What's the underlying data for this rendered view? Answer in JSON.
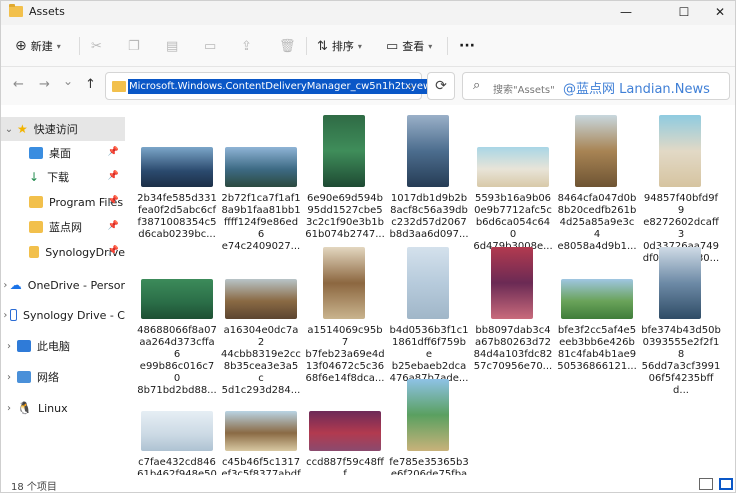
{
  "window": {
    "title": "Assets",
    "minimize": "—",
    "maximize": "☐",
    "close": "✕"
  },
  "toolbar": {
    "new_label": "新建",
    "sort_label": "排序",
    "view_label": "查看",
    "more_label": "···"
  },
  "nav": {
    "back": "←",
    "forward": "→",
    "recent": "⌄",
    "up": "↑"
  },
  "address": {
    "path": "Microsoft.Windows.ContentDeliveryManager_cw5n1h2txyew",
    "dropdown": "⌄",
    "refresh": "⟳"
  },
  "search": {
    "placeholder": "搜索\"Assets\""
  },
  "watermark": "@蓝点网 Landian.News",
  "sidebar": {
    "items": [
      {
        "label": "快速访问"
      },
      {
        "label": "桌面"
      },
      {
        "label": "下载"
      },
      {
        "label": "Program Files"
      },
      {
        "label": "蓝点网"
      },
      {
        "label": "SynologyDrive"
      },
      {
        "label": "OneDrive - Persor"
      },
      {
        "label": "Synology Drive - C"
      },
      {
        "label": "此电脑"
      },
      {
        "label": "网络"
      },
      {
        "label": "Linux"
      }
    ]
  },
  "files": [
    {
      "l1": "2b34fe585d331",
      "l2": "fea0f2d5abc6cf",
      "l3": "f3871008354c5",
      "l4": "d6cab0239bc..."
    },
    {
      "l1": "2b72f1ca7f1af1",
      "l2": "8a9b1faa81bb1",
      "l3": "ffff124f9e86ed6",
      "l4": "e74c2409027..."
    },
    {
      "l1": "6e90e69d594b",
      "l2": "95dd1527cbe5",
      "l3": "3c2c1f90e3b1b",
      "l4": "61b074b2747..."
    },
    {
      "l1": "1017db1d9b2b",
      "l2": "8acf8c56a39db",
      "l3": "c232d57d2067",
      "l4": "b8d3aa6d097..."
    },
    {
      "l1": "5593b16a9b06",
      "l2": "0e9b7712afc5c",
      "l3": "b6d6ca054c640",
      "l4": "6d479b3008e..."
    },
    {
      "l1": "8464cfa047d0b",
      "l2": "8b20cedfb261b",
      "l3": "4d25a85a9e3c4",
      "l4": "e8058a4d9b1..."
    },
    {
      "l1": "94857f40bfd9f9",
      "l2": "e8272602dcaff3",
      "l3": "0d33726aa749",
      "l4": "df056db1e30..."
    },
    {
      "l1": "48688066f8a07",
      "l2": "aa264d373cffa6",
      "l3": "e99b86c016c70",
      "l4": "8b71bd2bd88..."
    },
    {
      "l1": "a16304e0dc7a2",
      "l2": "44cbb8319e2cc",
      "l3": "8b35cea3e3a5c",
      "l4": "5d1c293d284..."
    },
    {
      "l1": "a1514069c95b7",
      "l2": "b7feb23a69e4d",
      "l3": "13f04672c5c36",
      "l4": "68f6e14f8dca..."
    },
    {
      "l1": "b4d0536b3f1c1",
      "l2": "1861dff6f759be",
      "l3": "b25ebaeb2dca",
      "l4": "476a87b7ade..."
    },
    {
      "l1": "bb8097dab3c4",
      "l2": "a67b80263d72",
      "l3": "84d4a103fdc82",
      "l4": "57c70956e70..."
    },
    {
      "l1": "bfe3f2cc5af4e5",
      "l2": "eeb3bb6e426b",
      "l3": "81c4fab4b1ae9",
      "l4": "50536866121..."
    },
    {
      "l1": "bfe374b43d50b",
      "l2": "0393555e2f2f18",
      "l3": "56dd7a3cf3991",
      "l4": "06f5f4235bffd..."
    },
    {
      "l1": "c7fae432cd846",
      "l2": "61b462f948e50",
      "l3": "",
      "l4": ""
    },
    {
      "l1": "c45b46f5c1317",
      "l2": "ef3c5f8377abdf",
      "l3": "",
      "l4": ""
    },
    {
      "l1": "ccd887f59c48fff",
      "l2": "d5e51ec0b98ac",
      "l3": "",
      "l4": ""
    },
    {
      "l1": "fe785e35365b3",
      "l2": "e6f206de75fba",
      "l3": "",
      "l4": ""
    }
  ],
  "status": {
    "count": "18 个项目"
  }
}
